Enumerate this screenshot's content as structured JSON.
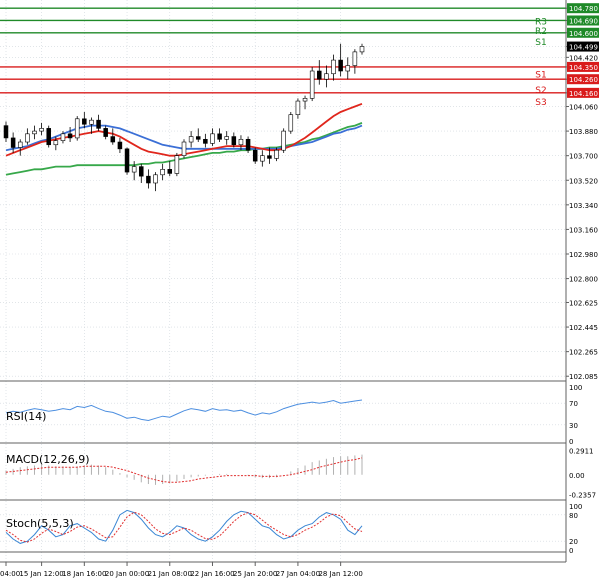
{
  "colors": {
    "background": "#ffffff",
    "grid": "#cfd6dc",
    "panel_border": "#606060",
    "bull": "#1c9e4a",
    "bear": "#d32f2f",
    "resistance": "#1f8a28",
    "support": "#d91c1c",
    "ma_fast": "#e0261c",
    "ma_mid": "#3b6fd6",
    "ma_slow": "#37a84a",
    "rsi": "#4d8fe0",
    "macd_hist": "#b0b0b0",
    "macd_signal": "#e03030",
    "stoch_main": "#3a86d4",
    "stoch_signal": "#e03030"
  },
  "chart_data": [
    {
      "type": "candlestick",
      "panel": "price",
      "y_axis_ticks": [
        "104.780",
        "104.690",
        "104.600",
        "104.499",
        "104.420",
        "104.350",
        "104.260",
        "104.160",
        "104.060",
        "103.880",
        "103.700",
        "103.520",
        "103.340",
        "103.160",
        "102.980",
        "102.800",
        "102.625",
        "102.445",
        "102.265",
        "102.085"
      ],
      "ylim": [
        102.05,
        104.84
      ],
      "levels": [
        {
          "name": "",
          "value": 104.78,
          "kind": "resistance"
        },
        {
          "name": "R3",
          "value": 104.69,
          "kind": "resistance"
        },
        {
          "name": "R2",
          "value": 104.6,
          "kind": "resistance"
        },
        {
          "name": "S1",
          "value": 104.35,
          "kind": "support"
        },
        {
          "name": "S2",
          "value": 104.26,
          "kind": "support"
        },
        {
          "name": "S3",
          "value": 104.16,
          "kind": "support"
        }
      ],
      "level_labels_right": [
        {
          "text": "R3",
          "value": 104.69,
          "kind": "resistance"
        },
        {
          "text": "R2",
          "value": 104.62,
          "kind": "resistance"
        },
        {
          "text": "S1",
          "value": 104.54,
          "kind": "resistance"
        },
        {
          "text": "S1",
          "value": 104.3,
          "kind": "support"
        },
        {
          "text": "S2",
          "value": 104.19,
          "kind": "support"
        },
        {
          "text": "S3",
          "value": 104.1,
          "kind": "support"
        }
      ],
      "last_price": "104.499",
      "candles": [
        [
          103.92,
          103.95,
          103.8,
          103.83
        ],
        [
          103.83,
          103.87,
          103.72,
          103.76
        ],
        [
          103.76,
          103.82,
          103.7,
          103.8
        ],
        [
          103.8,
          103.9,
          103.78,
          103.86
        ],
        [
          103.86,
          103.92,
          103.82,
          103.88
        ],
        [
          103.88,
          103.94,
          103.85,
          103.9
        ],
        [
          103.9,
          103.92,
          103.76,
          103.78
        ],
        [
          103.78,
          103.84,
          103.74,
          103.81
        ],
        [
          103.81,
          103.88,
          103.79,
          103.86
        ],
        [
          103.86,
          103.91,
          103.8,
          103.83
        ],
        [
          103.83,
          103.99,
          103.81,
          103.97
        ],
        [
          103.97,
          104.02,
          103.9,
          103.93
        ],
        [
          103.93,
          103.98,
          103.86,
          103.96
        ],
        [
          103.96,
          104.0,
          103.88,
          103.9
        ],
        [
          103.9,
          103.92,
          103.82,
          103.84
        ],
        [
          103.84,
          103.9,
          103.78,
          103.8
        ],
        [
          103.8,
          103.83,
          103.72,
          103.75
        ],
        [
          103.75,
          103.76,
          103.56,
          103.58
        ],
        [
          103.58,
          103.66,
          103.52,
          103.62
        ],
        [
          103.62,
          103.64,
          103.5,
          103.55
        ],
        [
          103.55,
          103.6,
          103.46,
          103.5
        ],
        [
          103.5,
          103.58,
          103.44,
          103.56
        ],
        [
          103.56,
          103.64,
          103.52,
          103.6
        ],
        [
          103.6,
          103.66,
          103.55,
          103.57
        ],
        [
          103.57,
          103.72,
          103.55,
          103.7
        ],
        [
          103.7,
          103.82,
          103.68,
          103.8
        ],
        [
          103.8,
          103.88,
          103.76,
          103.84
        ],
        [
          103.84,
          103.9,
          103.8,
          103.82
        ],
        [
          103.82,
          103.86,
          103.76,
          103.79
        ],
        [
          103.79,
          103.9,
          103.77,
          103.86
        ],
        [
          103.86,
          103.9,
          103.8,
          103.82
        ],
        [
          103.82,
          103.88,
          103.78,
          103.84
        ],
        [
          103.84,
          103.87,
          103.76,
          103.78
        ],
        [
          103.78,
          103.85,
          103.74,
          103.82
        ],
        [
          103.82,
          103.84,
          103.72,
          103.74
        ],
        [
          103.74,
          103.76,
          103.64,
          103.66
        ],
        [
          103.66,
          103.74,
          103.62,
          103.7
        ],
        [
          103.7,
          103.76,
          103.64,
          103.68
        ],
        [
          103.68,
          103.76,
          103.66,
          103.74
        ],
        [
          103.74,
          103.9,
          103.72,
          103.88
        ],
        [
          103.88,
          104.02,
          103.86,
          104.0
        ],
        [
          104.0,
          104.12,
          103.97,
          104.1
        ],
        [
          104.1,
          104.14,
          104.04,
          104.12
        ],
        [
          104.12,
          104.35,
          104.1,
          104.32
        ],
        [
          104.32,
          104.4,
          104.22,
          104.26
        ],
        [
          104.26,
          104.36,
          104.2,
          104.3
        ],
        [
          104.3,
          104.44,
          104.25,
          104.4
        ],
        [
          104.4,
          104.52,
          104.28,
          104.32
        ],
        [
          104.32,
          104.42,
          104.26,
          104.36
        ],
        [
          104.36,
          104.48,
          104.3,
          104.46
        ],
        [
          104.46,
          104.52,
          104.44,
          104.5
        ]
      ],
      "ma_fast": [
        103.7,
        103.72,
        103.74,
        103.76,
        103.78,
        103.8,
        103.81,
        103.82,
        103.83,
        103.84,
        103.85,
        103.86,
        103.87,
        103.88,
        103.87,
        103.86,
        103.84,
        103.81,
        103.78,
        103.75,
        103.73,
        103.72,
        103.71,
        103.7,
        103.7,
        103.71,
        103.72,
        103.73,
        103.74,
        103.75,
        103.76,
        103.77,
        103.77,
        103.77,
        103.77,
        103.76,
        103.75,
        103.74,
        103.74,
        103.75,
        103.77,
        103.8,
        103.83,
        103.87,
        103.91,
        103.95,
        103.99,
        104.02,
        104.04,
        104.06,
        104.08
      ],
      "ma_mid": [
        103.74,
        103.75,
        103.76,
        103.77,
        103.79,
        103.81,
        103.82,
        103.84,
        103.86,
        103.88,
        103.9,
        103.91,
        103.92,
        103.92,
        103.92,
        103.91,
        103.9,
        103.88,
        103.86,
        103.84,
        103.82,
        103.8,
        103.78,
        103.77,
        103.76,
        103.75,
        103.75,
        103.75,
        103.75,
        103.75,
        103.75,
        103.75,
        103.75,
        103.75,
        103.75,
        103.75,
        103.75,
        103.75,
        103.75,
        103.76,
        103.77,
        103.78,
        103.79,
        103.8,
        103.82,
        103.84,
        103.86,
        103.87,
        103.89,
        103.9,
        103.92
      ],
      "ma_slow": [
        103.56,
        103.57,
        103.58,
        103.59,
        103.6,
        103.6,
        103.61,
        103.62,
        103.62,
        103.62,
        103.63,
        103.63,
        103.63,
        103.63,
        103.63,
        103.63,
        103.63,
        103.63,
        103.63,
        103.64,
        103.64,
        103.65,
        103.65,
        103.66,
        103.67,
        103.68,
        103.69,
        103.7,
        103.71,
        103.72,
        103.72,
        103.73,
        103.73,
        103.74,
        103.74,
        103.75,
        103.75,
        103.76,
        103.76,
        103.77,
        103.78,
        103.79,
        103.8,
        103.82,
        103.83,
        103.85,
        103.87,
        103.89,
        103.91,
        103.92,
        103.94
      ]
    },
    {
      "type": "line",
      "panel": "rsi",
      "title": "RSI(14)",
      "y_axis_ticks": [
        "100",
        "70",
        "30",
        "0"
      ],
      "ylim": [
        0,
        100
      ],
      "values": [
        52,
        55,
        53,
        57,
        60,
        58,
        55,
        57,
        60,
        58,
        64,
        62,
        66,
        60,
        55,
        53,
        48,
        42,
        44,
        40,
        38,
        42,
        46,
        44,
        50,
        56,
        60,
        58,
        55,
        60,
        57,
        58,
        55,
        57,
        52,
        48,
        52,
        50,
        54,
        60,
        64,
        68,
        70,
        72,
        70,
        72,
        75,
        70,
        72,
        74,
        76
      ]
    },
    {
      "type": "bar",
      "panel": "macd",
      "title": "MACD(12,26,9)",
      "y_axis_ticks": [
        "0.2911",
        "0.00",
        "-0.2357"
      ],
      "ylim": [
        -0.3,
        0.33
      ],
      "histogram": [
        0.05,
        0.07,
        0.09,
        0.1,
        0.11,
        0.12,
        0.11,
        0.1,
        0.1,
        0.09,
        0.1,
        0.11,
        0.12,
        0.11,
        0.09,
        0.06,
        0.02,
        -0.03,
        -0.06,
        -0.09,
        -0.11,
        -0.12,
        -0.11,
        -0.1,
        -0.08,
        -0.05,
        -0.03,
        -0.02,
        -0.01,
        0.0,
        0.01,
        0.01,
        0.0,
        0.0,
        -0.01,
        -0.03,
        -0.04,
        -0.04,
        -0.03,
        0.0,
        0.04,
        0.08,
        0.11,
        0.15,
        0.17,
        0.19,
        0.21,
        0.22,
        0.22,
        0.23,
        0.24
      ],
      "signal": [
        0.03,
        0.04,
        0.05,
        0.06,
        0.07,
        0.08,
        0.09,
        0.09,
        0.09,
        0.09,
        0.09,
        0.1,
        0.1,
        0.1,
        0.1,
        0.09,
        0.07,
        0.05,
        0.02,
        -0.01,
        -0.04,
        -0.06,
        -0.08,
        -0.09,
        -0.09,
        -0.08,
        -0.07,
        -0.05,
        -0.04,
        -0.03,
        -0.02,
        -0.01,
        -0.01,
        -0.01,
        -0.01,
        -0.01,
        -0.02,
        -0.02,
        -0.02,
        -0.01,
        0.0,
        0.02,
        0.04,
        0.06,
        0.09,
        0.11,
        0.13,
        0.15,
        0.17,
        0.18,
        0.2
      ]
    },
    {
      "type": "line",
      "panel": "stoch",
      "title": "Stoch(5,5,3)",
      "y_axis_ticks": [
        "100",
        "80",
        "20",
        "0"
      ],
      "ylim": [
        0,
        100
      ],
      "main": [
        40,
        25,
        15,
        20,
        35,
        55,
        45,
        30,
        35,
        55,
        60,
        50,
        40,
        25,
        20,
        45,
        80,
        90,
        85,
        70,
        50,
        35,
        30,
        40,
        55,
        50,
        35,
        25,
        20,
        30,
        45,
        65,
        80,
        88,
        85,
        70,
        55,
        50,
        35,
        25,
        30,
        45,
        55,
        60,
        75,
        85,
        80,
        70,
        45,
        35,
        55
      ],
      "signal": [
        45,
        35,
        22,
        18,
        25,
        38,
        48,
        42,
        35,
        42,
        52,
        55,
        48,
        38,
        28,
        30,
        52,
        75,
        86,
        80,
        65,
        48,
        38,
        35,
        42,
        50,
        45,
        35,
        26,
        24,
        32,
        48,
        65,
        78,
        85,
        80,
        68,
        55,
        45,
        35,
        30,
        35,
        45,
        52,
        62,
        75,
        82,
        78,
        62,
        48,
        42
      ]
    }
  ],
  "x_axis_labels": [
    {
      "text": "04:00",
      "index": 0
    },
    {
      "text": "15 Jan 12:00",
      "index": 5
    },
    {
      "text": "18 Jan 16:00",
      "index": 11
    },
    {
      "text": "20 Jan 00:00",
      "index": 17
    },
    {
      "text": "21 Jan 08:00",
      "index": 23
    },
    {
      "text": "22 Jan 16:00",
      "index": 29
    },
    {
      "text": "25 Jan 20:00",
      "index": 35
    },
    {
      "text": "27 Jan 04:00",
      "index": 41
    },
    {
      "text": "28 Jan 12:00",
      "index": 47
    }
  ]
}
